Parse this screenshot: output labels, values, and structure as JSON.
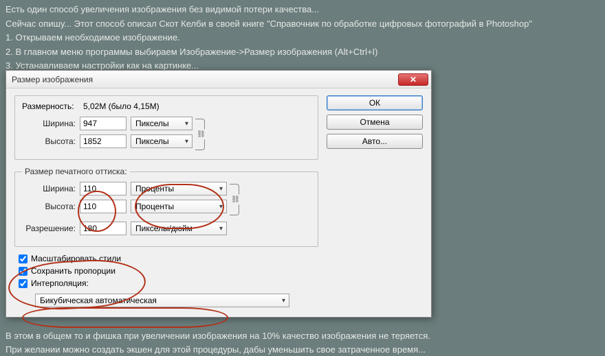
{
  "intro": {
    "l1": "Есть один способ увеличения изображения без видимой потери качества...",
    "l2": "Сейчас опишу... Этот способ описал Скот Келби в своей книге \"Справочник по обработке цифровых фотографий в Photoshop\"",
    "l3": "1. Открываем необходимое изображение.",
    "l4": "2. В главном меню программы выбираем Изображение->Размер изображения (Alt+Ctrl+I)",
    "l5": "3. Устанавливаем настройки как на картинке..."
  },
  "dialog": {
    "title": "Размер изображения",
    "close": "✕",
    "dimensions": {
      "header_label": "Размерность:",
      "header_value": "5,02M (было 4,15M)",
      "width_label": "Ширина:",
      "width_value": "947",
      "height_label": "Высота:",
      "height_value": "1852",
      "unit": "Пикселы"
    },
    "print": {
      "legend": "Размер печатного оттиска:",
      "width_label": "Ширина:",
      "width_value": "110",
      "height_label": "Высота:",
      "height_value": "110",
      "unit": "Проценты",
      "res_label": "Разрешение:",
      "res_value": "180",
      "res_unit": "Пикселы/дюйм"
    },
    "checks": {
      "scale_styles": "Масштабировать стили",
      "keep_prop": "Сохранить пропорции",
      "interp": "Интерполяция:"
    },
    "interp_mode": "Бикубическая автоматическая",
    "buttons": {
      "ok": "ОК",
      "cancel": "Отмена",
      "auto": "Авто..."
    }
  },
  "outro": {
    "l1": "В этом в общем то и фишка при увеличении изображения на 10% качество изображения не теряется.",
    "l2": "При желании можно создать экшен для этой процедуры, дабы уменьшить свое затраченное время..."
  }
}
